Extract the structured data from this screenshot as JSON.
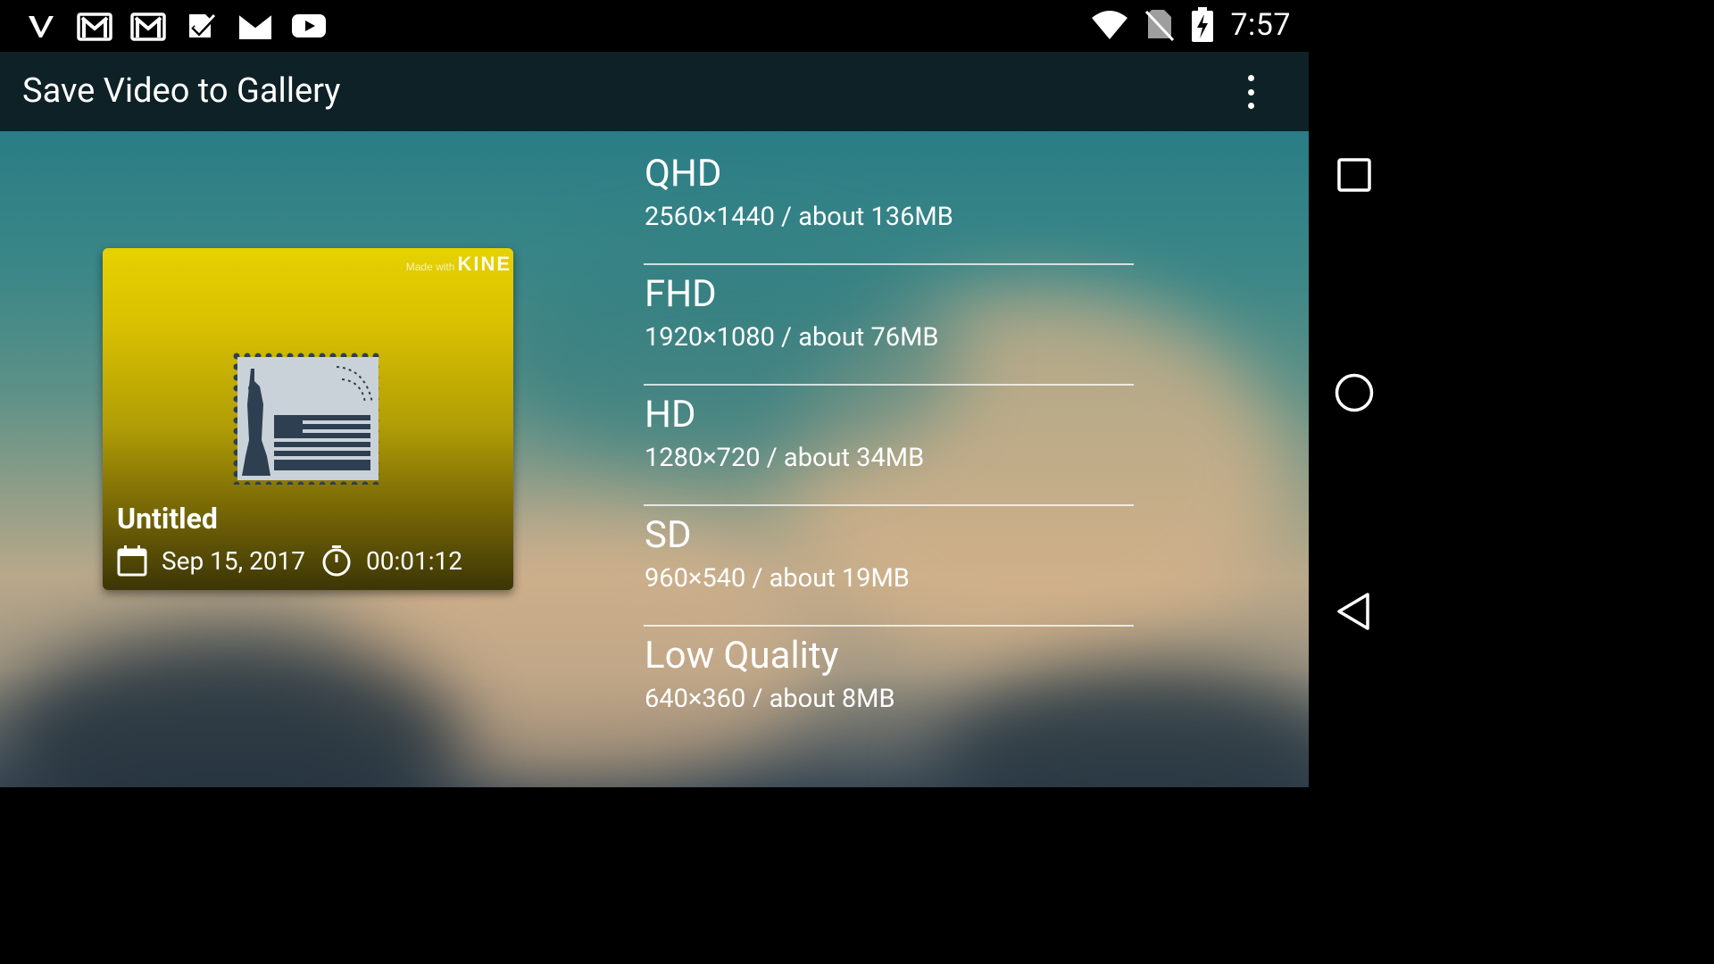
{
  "status_bar": {
    "time": "7:57",
    "left_icons": [
      "v-app-icon",
      "gmail-icon",
      "gmail-icon",
      "checkmark-app-icon",
      "gmail-m-icon",
      "youtube-icon"
    ],
    "right_icons": [
      "wifi-icon",
      "no-sim-icon",
      "battery-charging-icon"
    ]
  },
  "app_bar": {
    "title": "Save Video to Gallery",
    "menu_icon": "more-vert-icon"
  },
  "video": {
    "watermark_prefix": "Made with",
    "watermark_brand": "KINE",
    "title": "Untitled",
    "date": "Sep 15, 2017",
    "duration": "00:01:12",
    "thumbnail_icon": "statue-of-liberty-stamp-icon",
    "thumbnail_colors": [
      "#e6d100",
      "#3c3506"
    ]
  },
  "qualities": [
    {
      "name": "QHD",
      "desc": "2560×1440 / about 136MB"
    },
    {
      "name": "FHD",
      "desc": "1920×1080 / about 76MB"
    },
    {
      "name": "HD",
      "desc": "1280×720 / about 34MB"
    },
    {
      "name": "SD",
      "desc": "960×540 / about 19MB"
    },
    {
      "name": "Low Quality",
      "desc": "640×360 / about 8MB"
    }
  ],
  "nav_bar": {
    "buttons": [
      "recents-icon",
      "home-icon",
      "back-icon"
    ]
  },
  "colors": {
    "status_bar": "#000000",
    "app_bar": "#0e2126",
    "background_top": "#2a7d85",
    "background_mid": "#b9a88a",
    "text": "#ffffff"
  }
}
